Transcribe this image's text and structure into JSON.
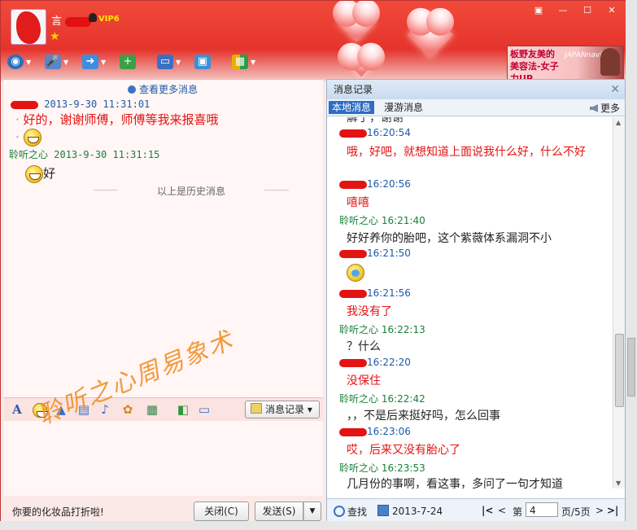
{
  "header": {
    "nickname": "言",
    "vip_badge": "VIP6",
    "ad_text": "板野友美的美容法-女子力UP",
    "ad_brand": "JAPANnavis",
    "window_buttons": [
      "▣",
      "—",
      "☐",
      "✕"
    ]
  },
  "toolbar": {
    "icons": [
      "video-icon",
      "voice-icon",
      "file-icon",
      "app-icon",
      "screen-icon",
      "remote-icon",
      "apps-grid-icon"
    ]
  },
  "chat": {
    "more_messages": "查看更多消息",
    "messages": [
      {
        "sender": "",
        "time": "2013-9-30 11:31:01",
        "lines": [
          "好的，谢谢师傅，师傅等我来报喜哦"
        ],
        "has_emoji": true
      },
      {
        "sender": "聆听之心",
        "time": "2013-9-30 11:31:15",
        "lines": [
          "好"
        ],
        "has_emoji": true
      }
    ],
    "history_divider": "以上是历史消息"
  },
  "watermark": "聆听之心周易象术",
  "compose": {
    "history_button": "消息记录",
    "ad_link": "你要的化妆品打折啦!",
    "close_button": "关闭(C)",
    "send_button": "发送(S)"
  },
  "record": {
    "title": "消息记录",
    "tab_local": "本地消息",
    "tab_roaming": "漫游消息",
    "more": "更多",
    "top_cutoff": "解了，谢谢",
    "entries": [
      {
        "who": "other",
        "sender": "",
        "time": "16:20:54",
        "text": "哦，好吧，就想知道上面说我什么好，什么不好"
      },
      {
        "who": "other",
        "sender": "",
        "time": "16:20:56",
        "text": "嘻嘻"
      },
      {
        "who": "me",
        "sender": "聆听之心",
        "time": "16:21:40",
        "text": "好好养你的胎吧，这个紫薇体系漏洞不小"
      },
      {
        "who": "other",
        "sender": "",
        "time": "16:21:50",
        "text": ""
      },
      {
        "who": "other",
        "sender": "",
        "time": "16:21:56",
        "text": "我没有了"
      },
      {
        "who": "me",
        "sender": "聆听之心",
        "time": "16:22:13",
        "text": "？什么"
      },
      {
        "who": "other",
        "sender": "",
        "time": "16:22:20",
        "text": "没保住"
      },
      {
        "who": "me",
        "sender": "聆听之心",
        "time": "16:22:42",
        "text": "，，不是后来挺好吗，怎么回事"
      },
      {
        "who": "other",
        "sender": "",
        "time": "16:23:06",
        "text": "哎，后来又没有胎心了"
      },
      {
        "who": "me",
        "sender": "聆听之心",
        "time": "16:23:53",
        "text": "几月份的事啊，看这事，多问了一句才知道"
      }
    ],
    "footer": {
      "search": "查找",
      "date": "2013-7-24",
      "page_prefix": "第",
      "page_value": "4",
      "page_suffix": "页/5页"
    }
  }
}
